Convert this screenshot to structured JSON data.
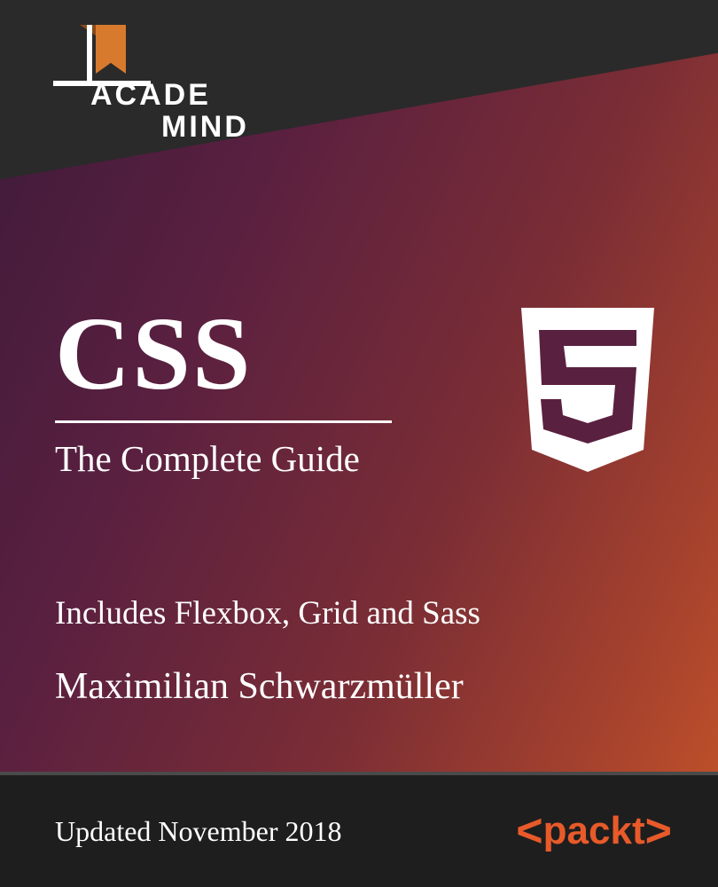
{
  "brand": {
    "logo_line1": "ACADE",
    "logo_line2": "MIND"
  },
  "title": "CSS",
  "subtitle": "The Complete Guide",
  "includes": "Includes Flexbox, Grid and Sass",
  "author": "Maximilian Schwarzmüller",
  "footer": {
    "updated": "Updated November 2018",
    "publisher": "packt"
  },
  "icon": {
    "css3_shield": "css3-shield-icon"
  }
}
